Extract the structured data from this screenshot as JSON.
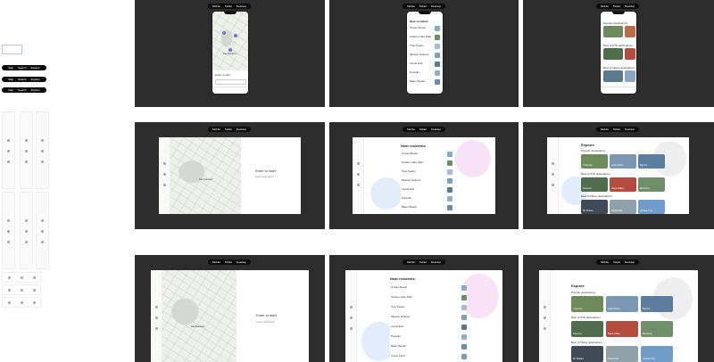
{
  "device_toggle": {
    "items": [
      "Mobile",
      "Tablet",
      "Desktop"
    ]
  },
  "sidebar": {
    "field_placeholder": "",
    "pills": [
      [
        "Map",
        "Search",
        "Explore"
      ],
      [
        "Map",
        "Search",
        "Explore"
      ],
      [
        "Map",
        "Search",
        "Explore"
      ],
      [
        "Map",
        "Search",
        "Explore"
      ]
    ]
  },
  "panels": {
    "map_title": "Enter to start",
    "map_subtitle": "Search destinations",
    "map_city": "San Francisco",
    "search_title": "Near residents",
    "search_items": [
      "Ocean Beach",
      "Golden Gate Park",
      "Twin Peaks",
      "Mission Dolores",
      "Lands End",
      "Presidio",
      "Baker Beach",
      "Crissy Field"
    ],
    "explore_title": "Explore",
    "explore_sections": [
      "Popular destinations",
      "Best of PTE destinations",
      "Best of hiking destinations"
    ],
    "explore_cards": [
      [
        "Yosemite",
        "Lake Tahoe",
        "Big Sur"
      ],
      [
        "Sonoma",
        "Napa Valley",
        "Monterey"
      ],
      [
        "Mt Shasta",
        "Redwoods",
        "Joshua Tree"
      ]
    ]
  },
  "colors": {
    "dark_bg": "#2d2d2d",
    "accent": "#7b6be6",
    "blob_pink": "#f8e2f5",
    "blob_blue": "#e3ecfb"
  }
}
